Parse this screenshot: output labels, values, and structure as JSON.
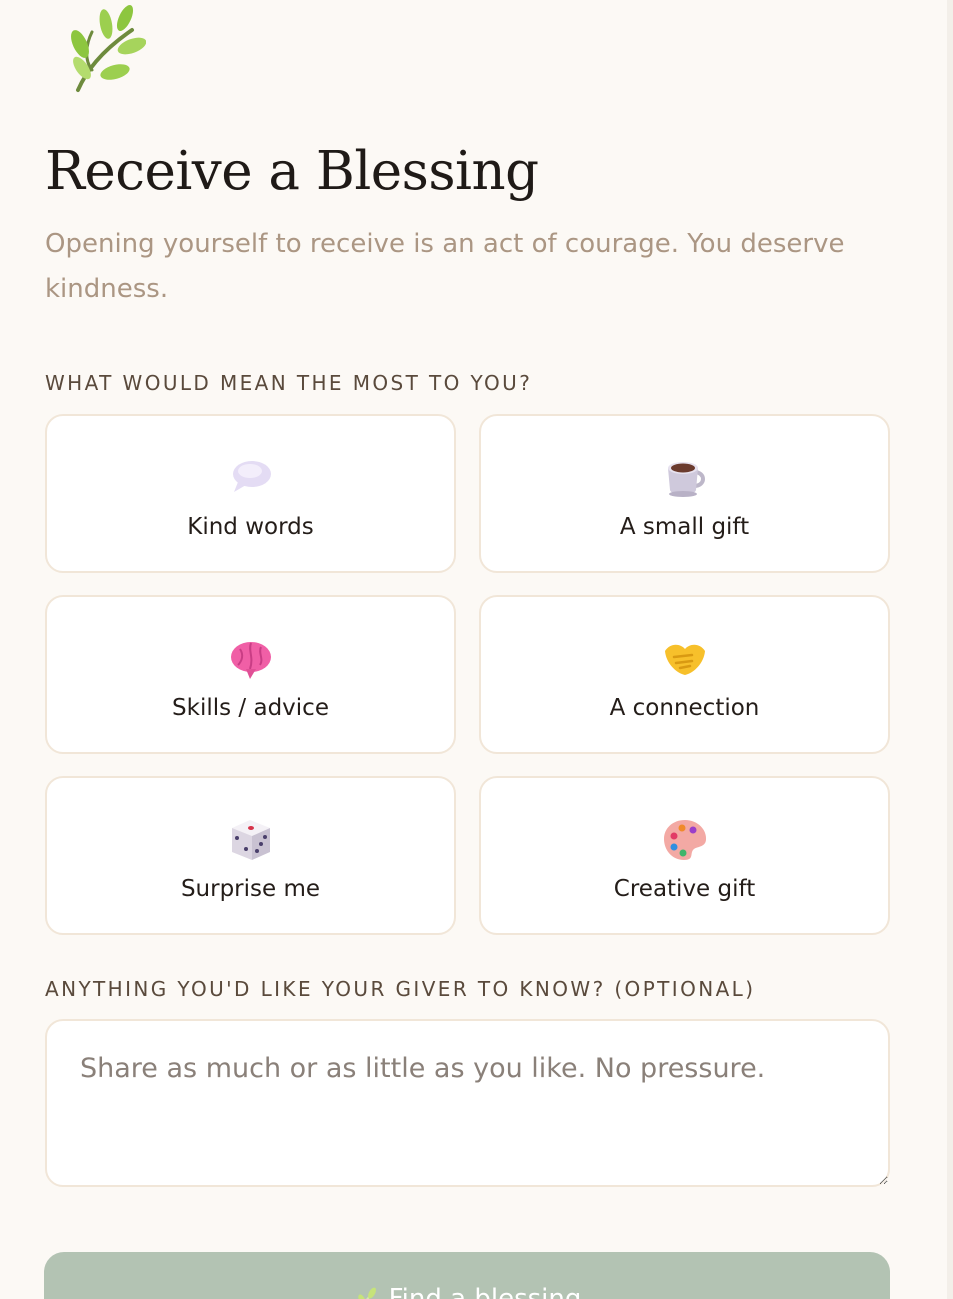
{
  "header": {
    "title": "Receive a Blessing",
    "subtitle": "Opening yourself to receive is an act of courage. You deserve kindness.",
    "logo_icon": "leaf-sprig-icon"
  },
  "options_section": {
    "label": "WHAT WOULD MEAN THE MOST TO YOU?",
    "options": [
      {
        "label": "Kind words",
        "icon": "speech-bubble-icon"
      },
      {
        "label": "A small gift",
        "icon": "coffee-cup-icon"
      },
      {
        "label": "Skills / advice",
        "icon": "brain-icon"
      },
      {
        "label": "A connection",
        "icon": "handshake-icon"
      },
      {
        "label": "Surprise me",
        "icon": "dice-icon"
      },
      {
        "label": "Creative gift",
        "icon": "palette-icon"
      }
    ]
  },
  "note_section": {
    "label": "ANYTHING YOU'D LIKE YOUR GIVER TO KNOW? (OPTIONAL)",
    "placeholder": "Share as much or as little as you like. No pressure.",
    "value": ""
  },
  "actions": {
    "find_label": "Find a blessing",
    "find_icon": "leaf-sprig-icon"
  },
  "colors": {
    "background": "#fcf9f5",
    "accent_green": "#b3c3b3",
    "subtitle": "#ab9683",
    "card_border": "#f1e6d8"
  }
}
